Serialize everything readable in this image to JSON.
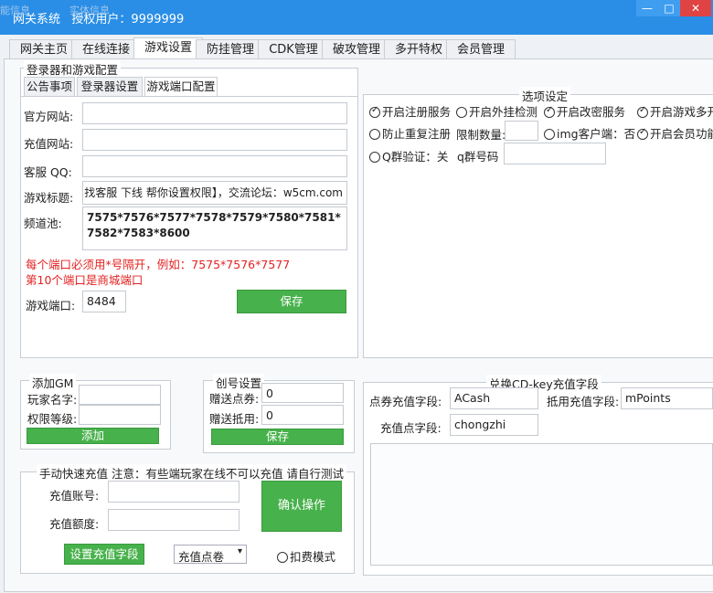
{
  "window": {
    "title": "网关系统",
    "user_label": "授权用户：9999999",
    "btn_min": "—",
    "btn_max": "□",
    "btn_close": "✕"
  },
  "ghost": [
    "能信息",
    "实体信息"
  ],
  "tabs": [
    "网关主页",
    "在线连接",
    "游戏设置",
    "防挂管理",
    "CDK管理",
    "破攻管理",
    "多开特权",
    "会员管理"
  ],
  "launcher": {
    "group_title": "登录器和游戏配置",
    "subtabs": [
      "公告事项",
      "登录器设置",
      "游戏端口配置"
    ],
    "official_site_label": "官方网站:",
    "official_site_value": "",
    "recharge_site_label": "充值网站:",
    "recharge_site_value": "",
    "qq_label": "客服 QQ:",
    "qq_value": "",
    "game_title_label": "游戏标题:",
    "game_title_value": "找客服 下线 帮你设置权限】，交流论坛：w5cm.com",
    "channel_label": "频道池:",
    "channel_value": "7575*7576*7577*7578*7579*7580*7581*7582*7583*8600",
    "note1": "每个端口必须用*号隔开，例如：7575*7576*7577",
    "note2": "第10个端口是商城端口",
    "port_label": "游戏端口:",
    "port_value": "8484",
    "save_label": "保存"
  },
  "options": {
    "title": "选项设定",
    "items": [
      {
        "label": "开启注册服务",
        "checked": true
      },
      {
        "label": "开启外挂检测",
        "checked": false
      },
      {
        "label": "开启改密服务",
        "checked": true
      },
      {
        "label": "开启游戏多开",
        "checked": true
      },
      {
        "label": "防止重复注册",
        "checked": false
      },
      {
        "label": "img客户端：否",
        "checked": false
      },
      {
        "label": "开启会员功能",
        "checked": true
      },
      {
        "label": "Q群验证：关",
        "checked": false
      }
    ],
    "limit_label": "限制数量:",
    "limit_value": "",
    "qgroup_label": "q群号码",
    "qgroup_value": ""
  },
  "gm": {
    "title": "添加GM",
    "player_label": "玩家名字:",
    "player_value": "",
    "level_label": "权限等级:",
    "level_value": "",
    "add_label": "添加"
  },
  "create": {
    "title": "创号设置",
    "gift_points_label": "赠送点券:",
    "gift_points_value": "0",
    "gift_credit_label": "赠送抵用:",
    "gift_credit_value": "0",
    "save_label": "保存"
  },
  "cdkey": {
    "title": "兑换CD-key充值字段",
    "points_field_label": "点券充值字段:",
    "points_field_value": "ACash",
    "credit_field_label": "抵用充值字段:",
    "credit_field_value": "mPoints",
    "recharge_points_label": "充值点字段:",
    "recharge_points_value": "chongzhi"
  },
  "manual": {
    "title": "手动快速充值  注意：有些端玩家在线不可以充值 请自行测试",
    "account_label": "充值账号:",
    "account_value": "",
    "amount_label": "充值额度:",
    "amount_value": "",
    "confirm_label": "确认操作",
    "set_field_label": "设置充值字段",
    "select_value": "充值点卷",
    "deduct_label": "扣费模式"
  }
}
